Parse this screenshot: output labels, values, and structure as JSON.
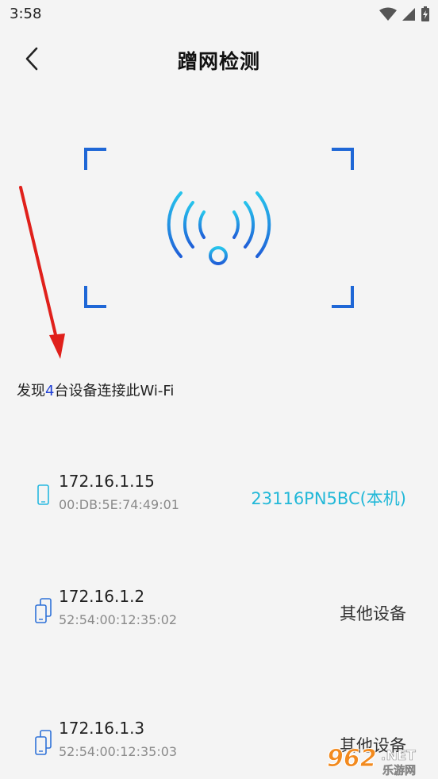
{
  "status_bar": {
    "time": "3:58"
  },
  "header": {
    "title": "蹭网检测"
  },
  "summary": {
    "prefix": "发现",
    "count": "4",
    "suffix": "台设备连接此Wi-Fi"
  },
  "devices": [
    {
      "ip": "172.16.1.15",
      "mac": "00:DB:5E:74:49:01",
      "tag": "23116PN5BC(本机)",
      "is_self": true
    },
    {
      "ip": "172.16.1.2",
      "mac": "52:54:00:12:35:02",
      "tag": "其他设备",
      "is_self": false
    },
    {
      "ip": "172.16.1.3",
      "mac": "52:54:00:12:35:03",
      "tag": "其他设备",
      "is_self": false
    }
  ],
  "colors": {
    "accent": "#1f67d6",
    "self_tag": "#22b8d8",
    "count": "#1f3fd6",
    "arrow": "#e0201b"
  },
  "watermark": {
    "number": "962",
    "suffix": ".NET",
    "subtitle": "乐游网"
  }
}
